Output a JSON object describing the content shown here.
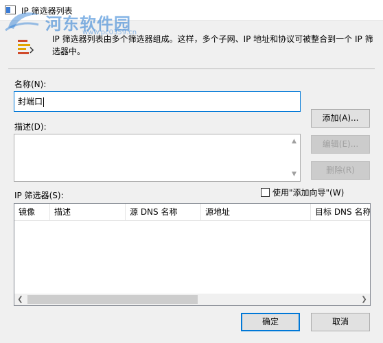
{
  "window": {
    "title": "IP 筛选器列表"
  },
  "watermark": {
    "text": "河东软件园",
    "url": "www.pc0359.cn"
  },
  "description": "IP 筛选器列表由多个筛选器组成。这样，多个子网、IP 地址和协议可被整合到一个 IP 筛选器中。",
  "name_field": {
    "label": "名称(N):",
    "value": "封端口"
  },
  "description_field": {
    "label": "描述(D):",
    "value": ""
  },
  "buttons": {
    "add": "添加(A)...",
    "edit": "编辑(E)...",
    "remove": "删除(R)",
    "ok": "确定",
    "cancel": "取消"
  },
  "filters": {
    "label": "IP 筛选器(S):",
    "wizard_checkbox_label": "使用\"添加向导\"(W)",
    "wizard_checked": false,
    "columns": [
      "镜像",
      "描述",
      "源 DNS 名称",
      "源地址",
      "目标 DNS 名称"
    ],
    "rows": []
  },
  "colors": {
    "accent": "#0078d7",
    "watermark": "#2378d2"
  }
}
